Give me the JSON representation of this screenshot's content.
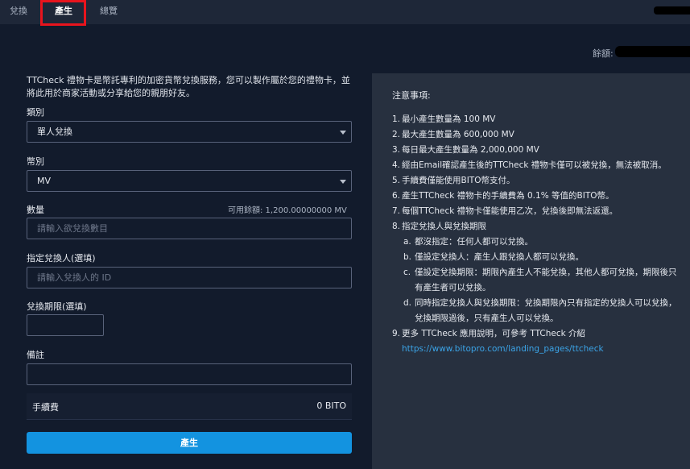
{
  "tabs": [
    "兌換",
    "產生",
    "總覽"
  ],
  "active_tab": "產生",
  "balance_label": "餘額:",
  "intro": "TTCheck 禮物卡是幣託專利的加密貨幣兌換服務，您可以製作屬於您的禮物卡，並將此用於商家活動或分享給您的親朋好友。",
  "form": {
    "category_label": "類別",
    "category_value": "單人兌換",
    "currency_label": "幣別",
    "currency_value": "MV",
    "amount_label": "數量",
    "available": "可用餘額: 1,200.00000000 MV",
    "amount_placeholder": "請輸入欲兌換數目",
    "recipient_label": "指定兌換人(選填)",
    "recipient_placeholder": "請輸入兌換人的 ID",
    "deadline_label": "兌換期限(選填)",
    "memo_label": "備註",
    "fee_label": "手續費",
    "fee_value": "0 BITO",
    "submit_label": "產生"
  },
  "notes": {
    "title": "注意事項:",
    "items": [
      {
        "n": "1.",
        "t": "最小產生數量為 100 MV"
      },
      {
        "n": "2.",
        "t": "最大產生數量為 600,000 MV"
      },
      {
        "n": "3.",
        "t": "每日最大產生數量為 2,000,000 MV"
      },
      {
        "n": "4.",
        "t": "經由Email確認產生後的TTCheck 禮物卡僅可以被兌換，無法被取消。"
      },
      {
        "n": "5.",
        "t": "手續費僅能使用BITO幣支付。"
      },
      {
        "n": "6.",
        "t": "產生TTCheck 禮物卡的手續費為 0.1% 等值的BITO幣。"
      },
      {
        "n": "7.",
        "t": "每個TTCheck 禮物卡僅能使用乙次，兌換後即無法返還。"
      },
      {
        "n": "8.",
        "t": "指定兌換人與兌換期限"
      }
    ],
    "sub_items": [
      {
        "n": "a.",
        "t": "都沒指定：任何人都可以兌換。"
      },
      {
        "n": "b.",
        "t": "僅設定兌換人：產生人跟兌換人都可以兌換。"
      },
      {
        "n": "c.",
        "t": "僅設定兌換期限：期限內產生人不能兌換，其他人都可兌換，期限後只有產生者可以兌換。"
      },
      {
        "n": "d.",
        "t": "同時指定兌換人與兌換期限：兌換期限內只有指定的兌換人可以兌換，兌換期限過後，只有產生人可以兌換。"
      }
    ],
    "final_item": {
      "n": "9.",
      "t": "更多 TTCheck 應用說明，可參考 TTCheck 介紹"
    },
    "link": "https://www.bitopro.com/landing_pages/ttcheck"
  }
}
